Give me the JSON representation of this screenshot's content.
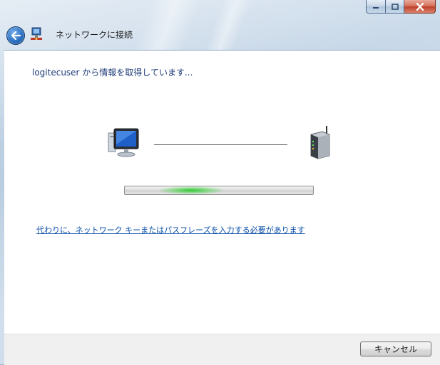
{
  "window": {
    "title": "ネットワークに接続",
    "caption_buttons": [
      "minimize",
      "maximize",
      "close"
    ]
  },
  "content": {
    "status_text": "logitecuser から情報を取得しています...",
    "link_text": "代わりに、ネットワーク キーまたはパスフレーズを入力する必要があります"
  },
  "progress": {
    "style": "indeterminate-marquee",
    "accent_color": "#33c233"
  },
  "footer": {
    "cancel_label": "キャンセル"
  },
  "icons": {
    "back": "back-arrow-icon",
    "title": "network-icon",
    "computer": "computer-icon",
    "router": "router-icon"
  }
}
